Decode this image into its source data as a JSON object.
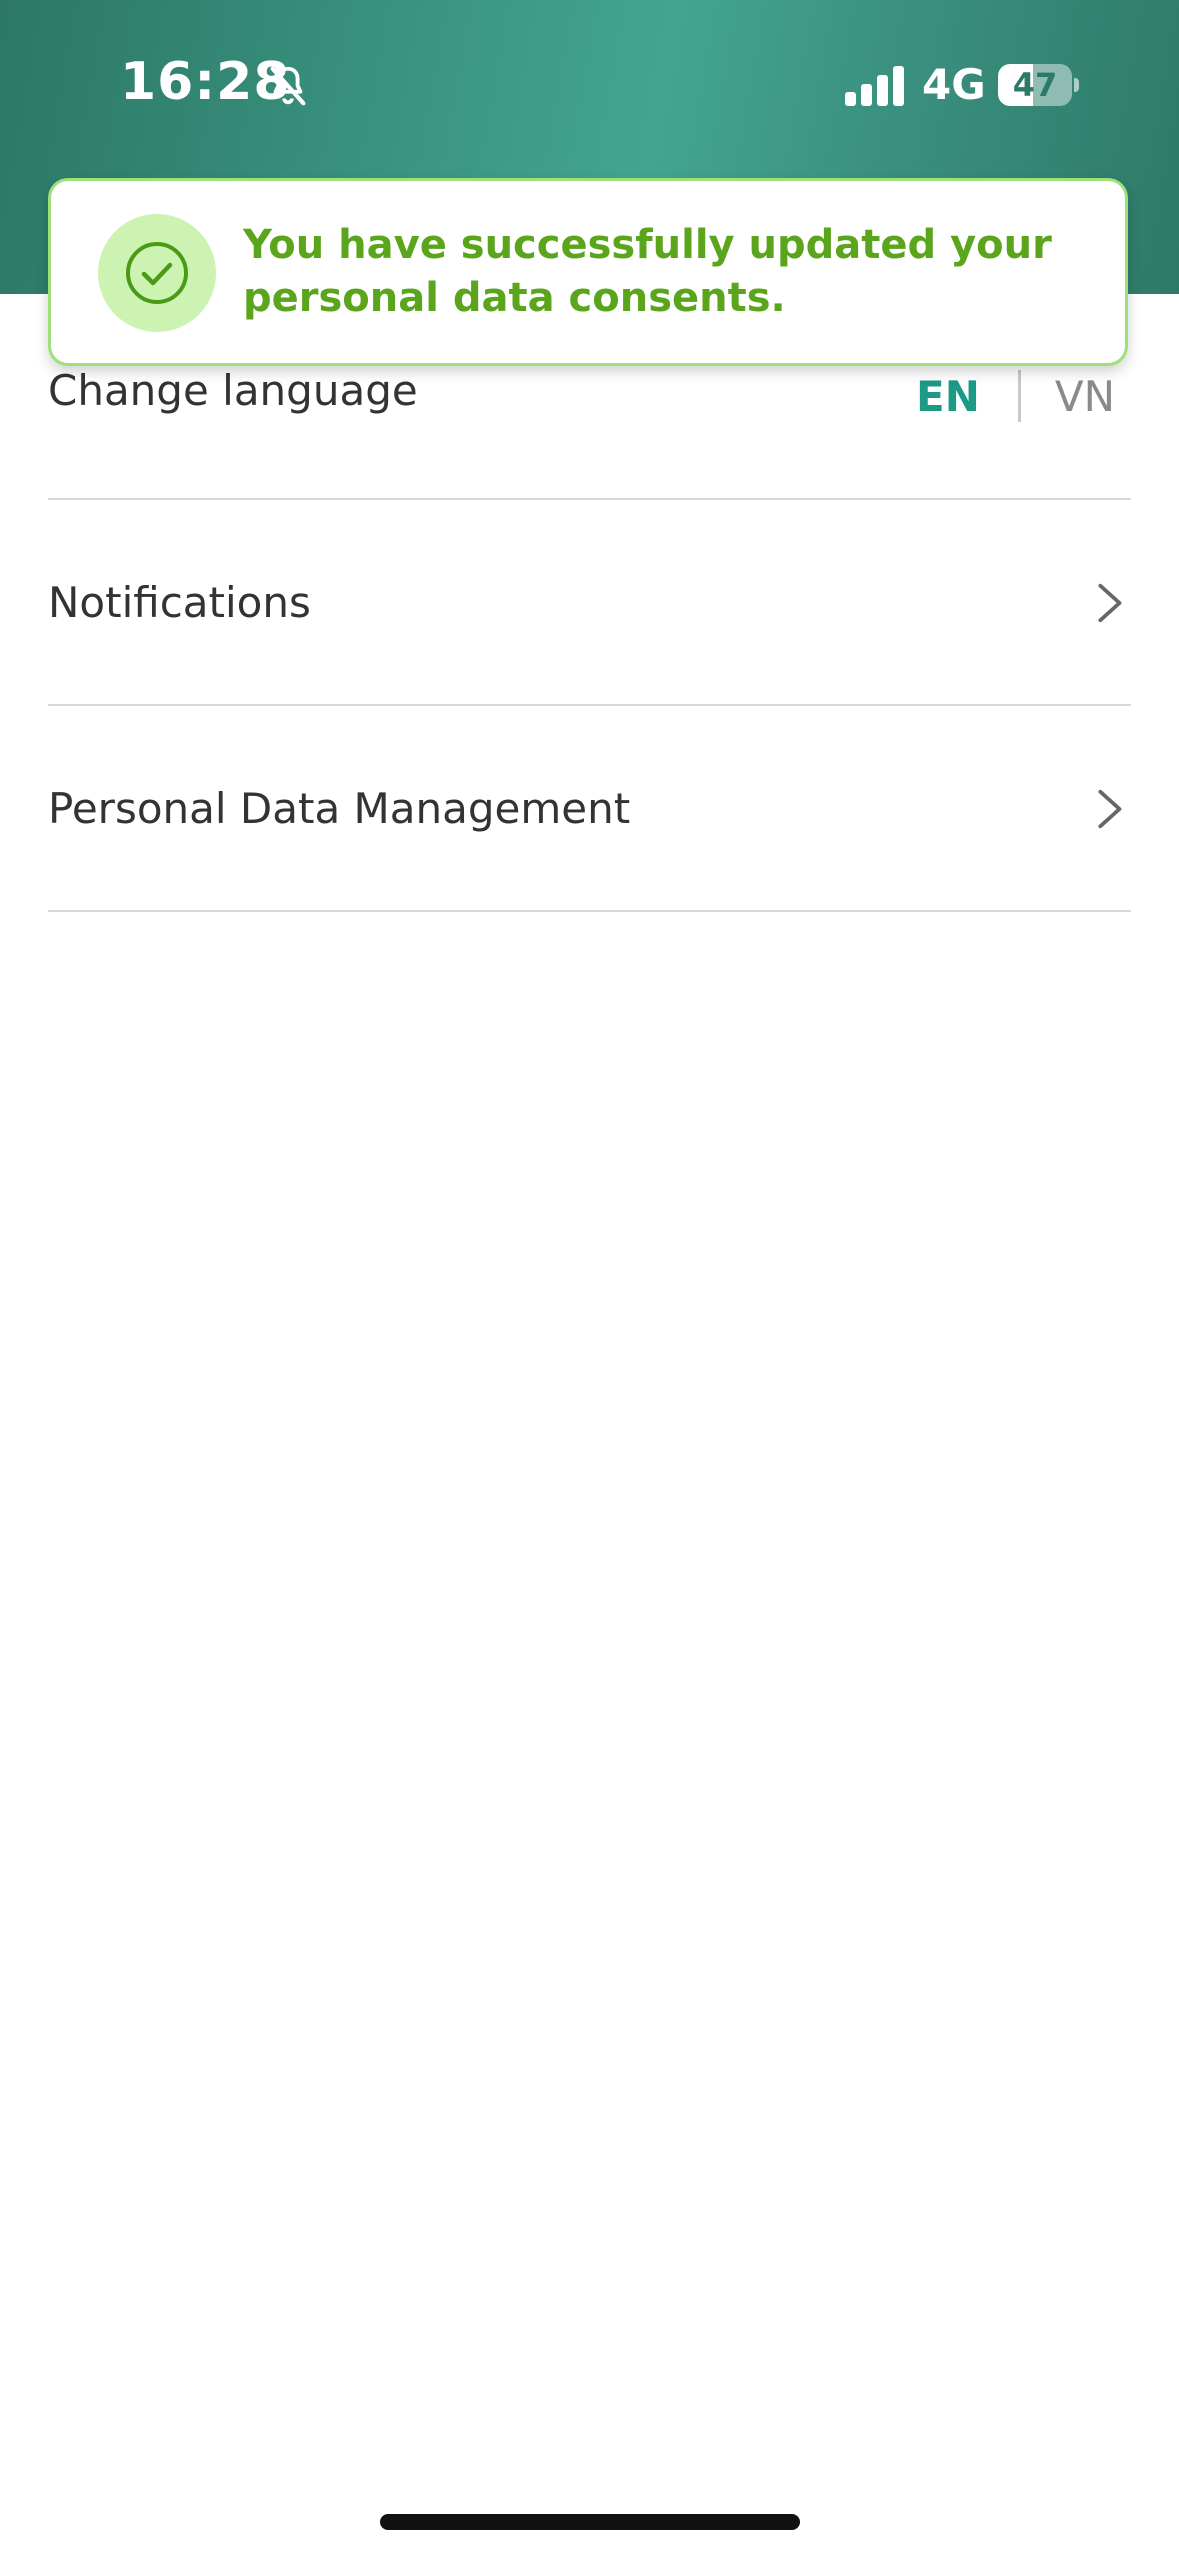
{
  "status_bar": {
    "time": "16:28",
    "network": "4G",
    "battery_level": "47",
    "battery_fraction": 0.47,
    "icons": [
      "bell-slash-icon",
      "cellular-signal-icon",
      "battery-icon"
    ]
  },
  "toast": {
    "message": "You have successfully updated your personal data consents.",
    "icon": "check-circle-icon",
    "text_color": "#5aa51c",
    "border_color": "#9ee07a"
  },
  "settings": {
    "change_language": {
      "label": "Change language",
      "options": [
        "EN",
        "VN"
      ],
      "selected": "EN"
    },
    "notifications": {
      "label": "Notifications",
      "icon": "chevron-right-icon"
    },
    "personal_data": {
      "label": "Personal Data Management",
      "icon": "chevron-right-icon"
    }
  },
  "colors": {
    "header_accent": "#3a9482",
    "language_selected": "#1c9a86",
    "language_unselected": "#8a8a8a"
  }
}
